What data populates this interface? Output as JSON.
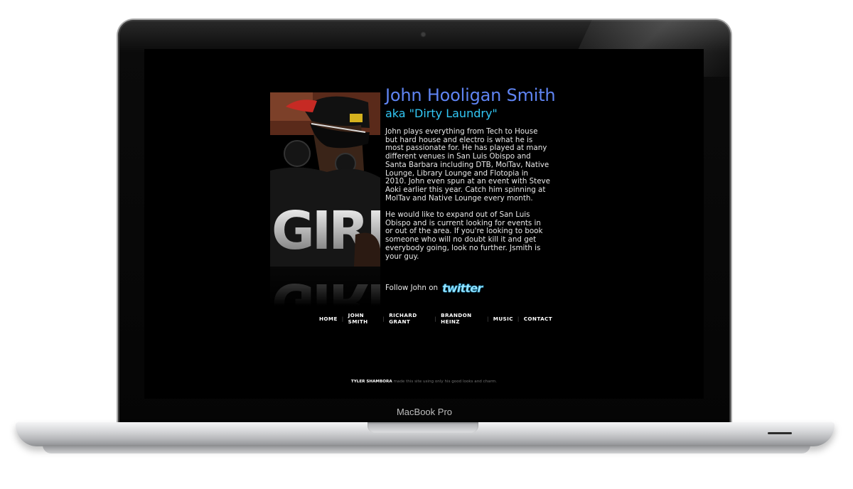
{
  "device": {
    "label": "MacBook Pro"
  },
  "site": {
    "title": "John Hooligan Smith",
    "subtitle": "aka \"Dirty Laundry\"",
    "bio": [
      "John plays everything from Tech to House but hard house and electro is what he is most passionate for. He has played at many different venues in San Luis Obispo and Santa Barbara including DTB, MolTav, Native Lounge, Library Lounge and Flotopia in 2010. John even spun at an event with Steve Aoki earlier this year. Catch him spinning at MolTav and Native Lounge every month.",
      "He would like to expand out of San Luis Obispo and is current looking for events in or out of the area. If you're looking to book someone who will no doubt kill it and get everybody going, look no further. Jsmith is your guy."
    ],
    "follow_text": "Follow John on",
    "twitter_label": "twitter",
    "photo_shirt_text": "GIRL",
    "nav": [
      "HOME",
      "JOHN SMITH",
      "RICHARD GRANT",
      "BRANDON HEINZ",
      "MUSIC",
      "CONTACT"
    ],
    "footer": {
      "name": "TYLER SHAMBORA",
      "text": "made this site using only his good looks and charm."
    },
    "colors": {
      "background": "#000000",
      "title": "#5f84f2",
      "subtitle": "#32c8f6",
      "body_text": "#e8e8e8"
    }
  }
}
